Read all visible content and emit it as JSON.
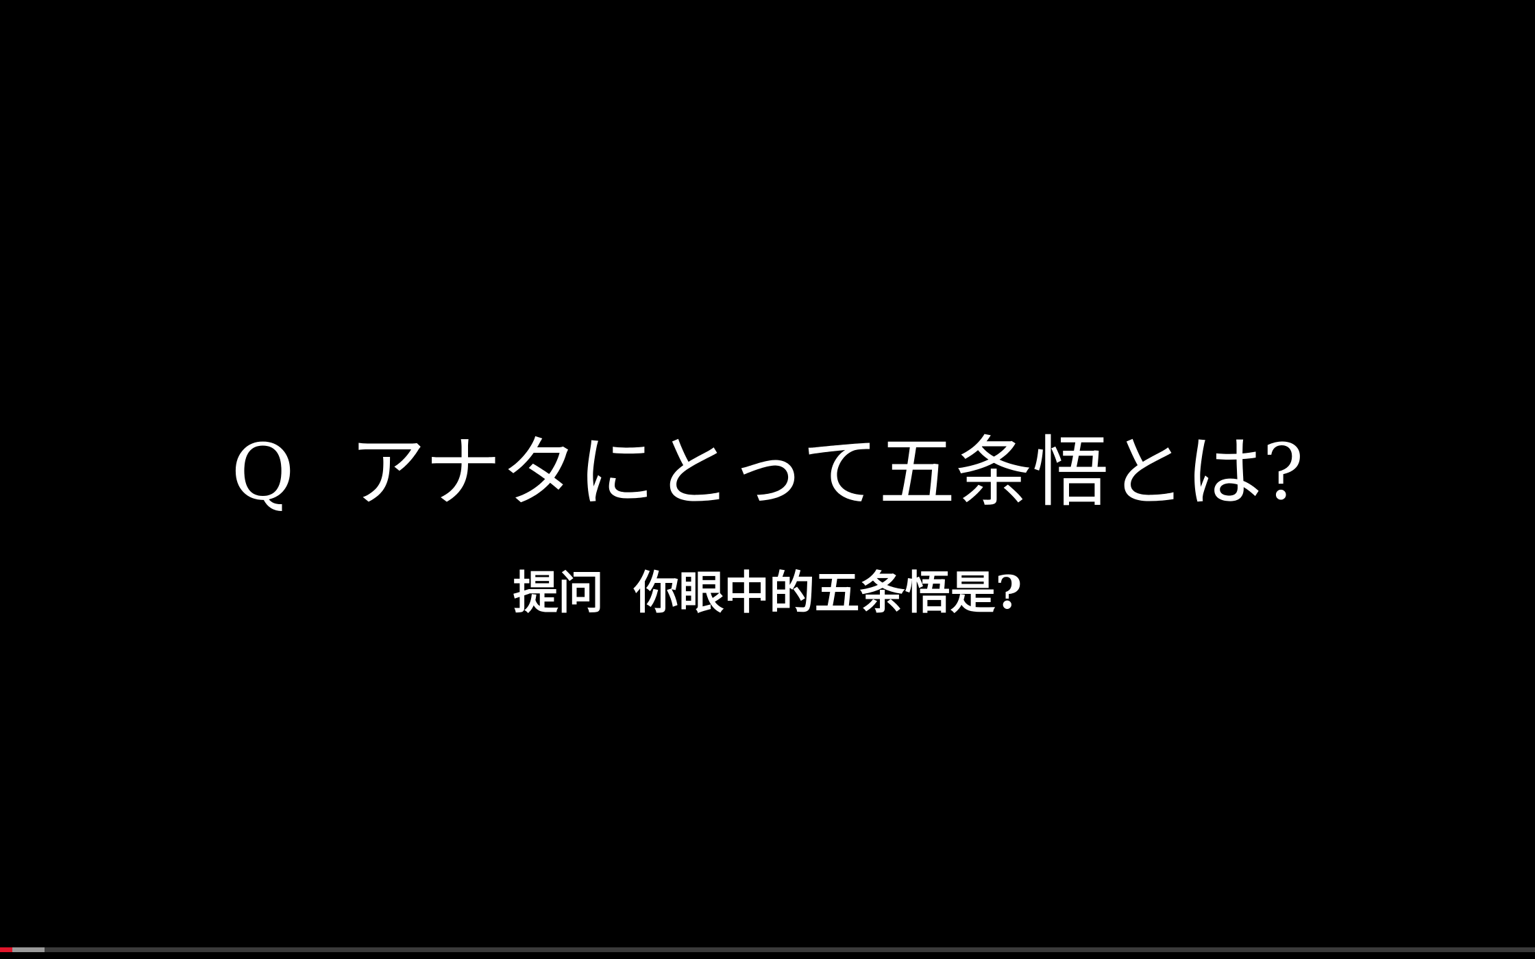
{
  "caption": {
    "question_mark": "Q",
    "question_text": "アナタにとって五条悟とは?",
    "translation_label": "提问",
    "translation_text": "你眼中的五条悟是?"
  },
  "player": {
    "played_fraction": 0.008,
    "buffered_fraction": 0.029,
    "colors": {
      "played": "#e0162b",
      "buffered": "#9a9a9a",
      "track": "#3a3a3a",
      "background": "#000000",
      "caption": "#ffffff"
    }
  }
}
